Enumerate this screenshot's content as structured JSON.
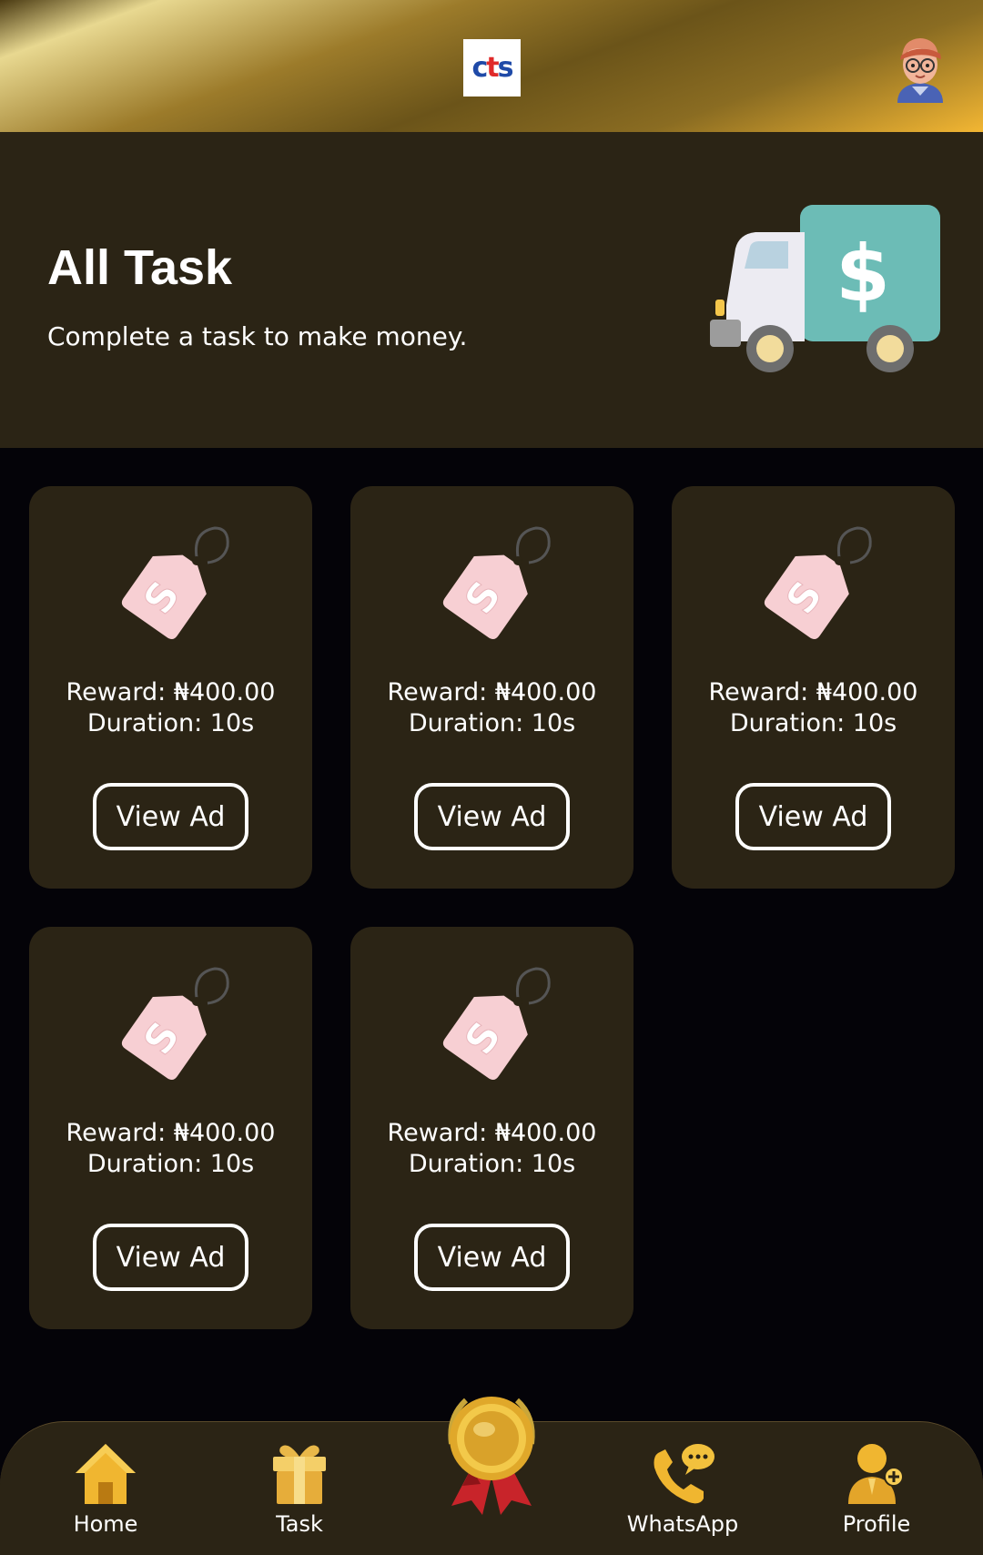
{
  "header": {
    "logo_text_1": "c",
    "logo_text_2": "t",
    "logo_text_3": "s"
  },
  "hero": {
    "title": "All Task",
    "subtitle": "Complete a task to make money."
  },
  "tasks": [
    {
      "reward": "Reward: ₦400.00",
      "duration": "Duration: 10s",
      "button": "View Ad"
    },
    {
      "reward": "Reward: ₦400.00",
      "duration": "Duration: 10s",
      "button": "View Ad"
    },
    {
      "reward": "Reward: ₦400.00",
      "duration": "Duration: 10s",
      "button": "View Ad"
    },
    {
      "reward": "Reward: ₦400.00",
      "duration": "Duration: 10s",
      "button": "View Ad"
    },
    {
      "reward": "Reward: ₦400.00",
      "duration": "Duration: 10s",
      "button": "View Ad"
    }
  ],
  "nav": {
    "home": "Home",
    "task": "Task",
    "whatsapp": "WhatsApp",
    "profile": "Profile"
  },
  "icons": {
    "home": "home-icon",
    "task": "gift-icon",
    "center": "gold-medal-icon",
    "whatsapp": "phone-chat-icon",
    "profile": "user-add-icon",
    "task_card": "price-tag-icon",
    "hero": "money-truck-icon"
  },
  "colors": {
    "page_bg": "#040308",
    "panel": "#2b2415",
    "gold": "#f2b633",
    "tag_pink": "#f7cfd3",
    "truck_teal": "#6cbcb6"
  }
}
